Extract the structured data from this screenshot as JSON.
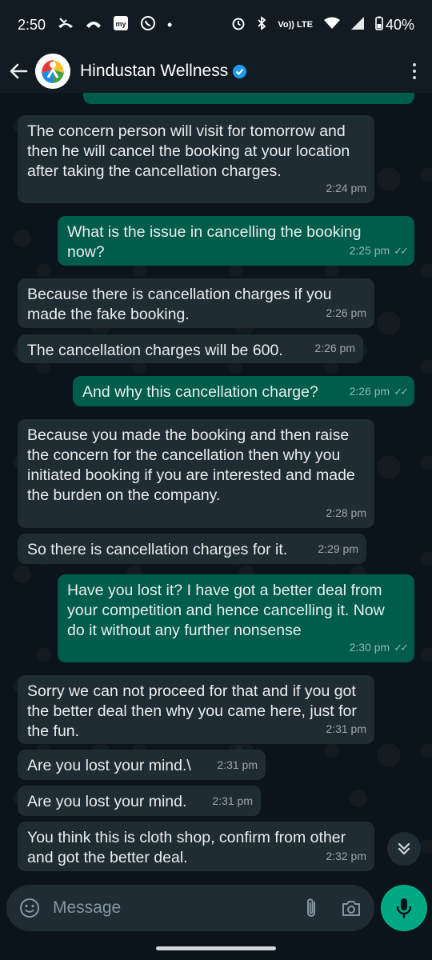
{
  "status_bar": {
    "time": "2:50",
    "network": "Vo)) LTE",
    "battery": "40%",
    "dot": "•"
  },
  "header": {
    "contact_name": "Hindustan Wellness"
  },
  "messages": [
    {
      "dir": "in",
      "text": "The concern person will visit for tomorrow and then he will cancel the booking at your location after taking the cancellation charges.",
      "time": "2:24 pm"
    },
    {
      "dir": "out",
      "text": "What is the issue in cancelling the booking now?",
      "time": "2:25 pm"
    },
    {
      "dir": "in",
      "text": "Because there is cancellation charges if you made the fake booking.",
      "time": "2:26 pm"
    },
    {
      "dir": "in",
      "text": "The cancellation charges will be 600.",
      "time": "2:26 pm"
    },
    {
      "dir": "out",
      "text": "And why this cancellation charge?",
      "time": "2:26 pm"
    },
    {
      "dir": "in",
      "text": "Because you made the booking and then raise the concern for the cancellation then why you initiated booking if you are interested and made the burden on the company.",
      "time": "2:28 pm"
    },
    {
      "dir": "in",
      "text": "So there is cancellation charges for it.",
      "time": "2:29 pm"
    },
    {
      "dir": "out",
      "text": "Have you lost it? I have got a better deal from your competition and hence cancelling it. Now do it without any further nonsense",
      "time": "2:30 pm"
    },
    {
      "dir": "in",
      "text": "Sorry we can not proceed for that and if you got the better deal then why you came here, just for the fun.",
      "time": "2:31 pm"
    },
    {
      "dir": "in",
      "text": "Are you lost your mind.\\",
      "time": "2:31 pm"
    },
    {
      "dir": "in",
      "text": "Are you lost your mind.",
      "time": "2:31 pm"
    },
    {
      "dir": "in",
      "text": "You think this is cloth shop, confirm from other and got the better deal.",
      "time": "2:32 pm"
    }
  ],
  "composer": {
    "placeholder": "Message"
  },
  "icons": {
    "back": "arrow-left",
    "verified": "verified-badge",
    "menu": "more-vert",
    "emoji": "emoji",
    "attach": "paperclip",
    "camera": "camera",
    "mic": "microphone",
    "scroll_down": "double-chevron-down",
    "read_ticks": "double-check"
  },
  "colors": {
    "incoming_bubble": "#202c33",
    "outgoing_bubble": "#005c4b",
    "accent": "#00a884",
    "background": "#0b141a"
  }
}
